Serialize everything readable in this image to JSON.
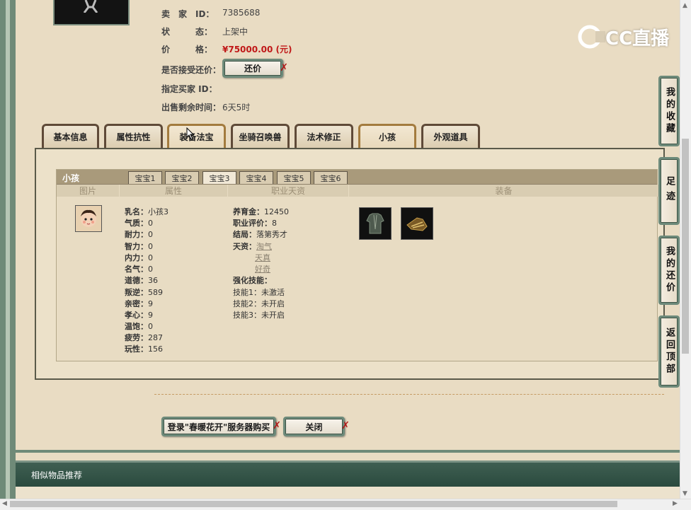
{
  "seller": {
    "id_label": "卖　家　ID：",
    "id_value": "7385688",
    "status_label": "状　　　态：",
    "status_value": "上架中",
    "price_label": "价　　　格：",
    "price_value": "¥75000.00 (元)",
    "counter_label": "是否接受还价：",
    "counter_button": "还价",
    "buyer_label": "指定买家 ID：",
    "time_label": "出售剩余时间：",
    "time_value": "6天5时"
  },
  "tabs": [
    "基本信息",
    "属性抗性",
    "装备法宝",
    "坐骑召唤兽",
    "法术修正",
    "小孩",
    "外观道具"
  ],
  "child_panel": {
    "title": "小孩",
    "subtabs": [
      "宝宝1",
      "宝宝2",
      "宝宝3",
      "宝宝4",
      "宝宝5",
      "宝宝6"
    ],
    "columns": [
      "图片",
      "属性",
      "职业天资",
      "装备"
    ],
    "attributes": [
      {
        "k": "乳名：",
        "v": "小孩3"
      },
      {
        "k": "气质：",
        "v": "0"
      },
      {
        "k": "耐力：",
        "v": "0"
      },
      {
        "k": "智力：",
        "v": "0"
      },
      {
        "k": "内力：",
        "v": "0"
      },
      {
        "k": "名气：",
        "v": "0"
      },
      {
        "k": "道德：",
        "v": "36"
      },
      {
        "k": "叛逆：",
        "v": "589"
      },
      {
        "k": "亲密：",
        "v": "9"
      },
      {
        "k": "孝心：",
        "v": "9"
      },
      {
        "k": "温饱：",
        "v": "0"
      },
      {
        "k": "疲劳：",
        "v": "287"
      },
      {
        "k": "玩性：",
        "v": "156"
      }
    ],
    "career": [
      {
        "k": "养育金：",
        "v": "12450"
      },
      {
        "k": "职业评价：",
        "v": "8"
      },
      {
        "k": "结局：",
        "v": "落第秀才"
      },
      {
        "k": "天资：",
        "v": "淘气"
      }
    ],
    "talents_extra": [
      "天真",
      "好奇"
    ],
    "skills_label": "强化技能：",
    "skills": [
      {
        "k": "技能1：",
        "v": "未激活"
      },
      {
        "k": "技能2：",
        "v": "未开启"
      },
      {
        "k": "技能3：",
        "v": "未开启"
      }
    ]
  },
  "buttons": {
    "login_buy": "登录\"春暖花开\"服务器购买",
    "close": "关闭"
  },
  "sidebar": [
    "我的收藏",
    "足迹",
    "我的还价",
    "返回顶部"
  ],
  "similar_title": "相似物品推荐",
  "watermark": "CC直播"
}
